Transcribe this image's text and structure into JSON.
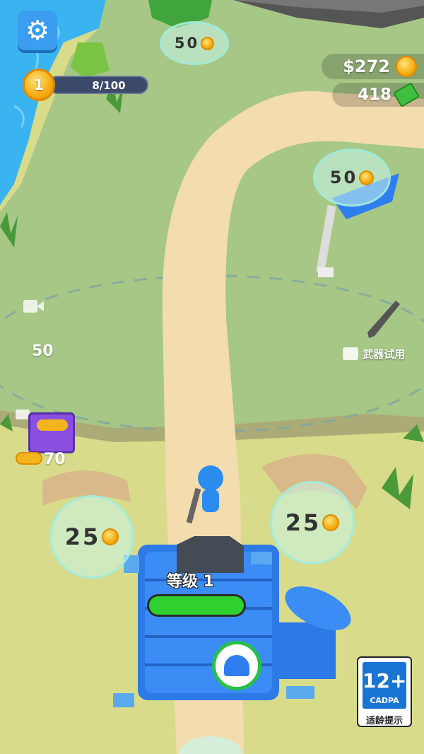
{
  "hud": {
    "level_number": "1",
    "xp_progress": "8/100",
    "money": "$272",
    "cash": "418"
  },
  "world": {
    "circle_top": "50",
    "circle_flag": "50",
    "circle_left": "25",
    "circle_right": "25",
    "ad_slot_left_value": "50",
    "chest_value": "70",
    "weapon_trial_label": "武器试用",
    "base_level_label": "等级 1"
  },
  "rating": {
    "age": "12+",
    "org": "CADPA",
    "note": "适龄提示"
  },
  "colors": {
    "water": "#3ab4f0",
    "grass": "#a6c786",
    "sand": "#d8dc8a",
    "path": "#f3dcae",
    "base_blue": "#2d7ae6",
    "xp_green": "#2fd12f"
  }
}
